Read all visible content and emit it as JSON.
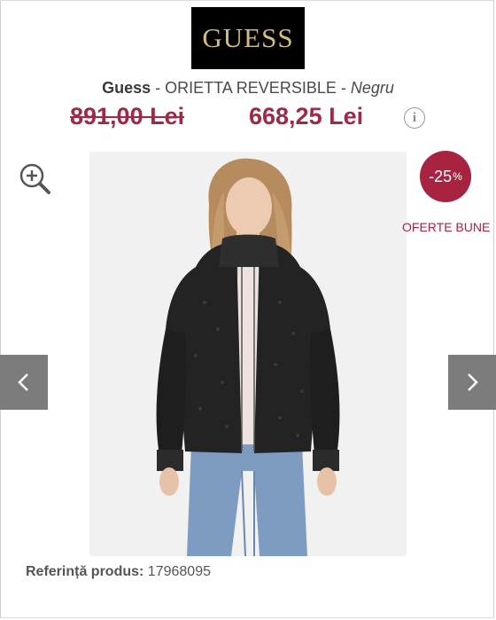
{
  "brand": {
    "logo_text": "GUESS"
  },
  "product": {
    "brand_name": "Guess",
    "separator": " - ",
    "model": "ORIETTA REVERSIBLE",
    "color": "Negru"
  },
  "pricing": {
    "old_price": "891,00 Lei",
    "new_price": "668,25 Lei",
    "info_icon_glyph": "i"
  },
  "promo": {
    "discount_value": "-25",
    "discount_unit": "%",
    "offer_label": "OFERTE BUNE",
    "accent_color": "#a8233f"
  },
  "gallery": {
    "prev_glyph": "‹",
    "next_glyph": "›"
  },
  "reference": {
    "label": "Referință produs:",
    "value": "17968095"
  },
  "icons": [
    "zoom-in-icon",
    "info-icon",
    "chevron-left-icon",
    "chevron-right-icon"
  ]
}
